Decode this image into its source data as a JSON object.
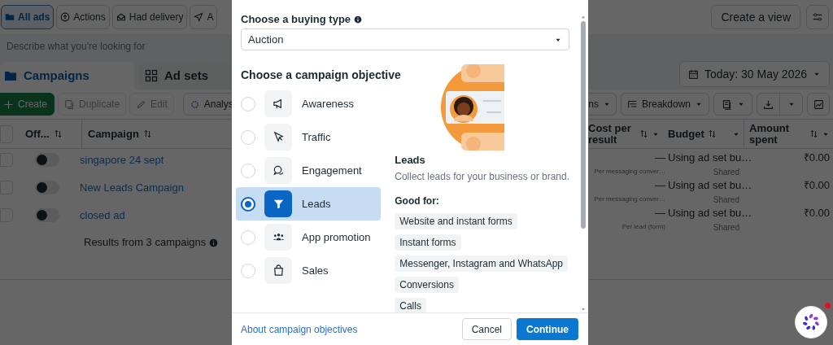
{
  "filters": [
    {
      "label": "All ads",
      "selected": true
    },
    {
      "label": "Actions",
      "selected": false
    },
    {
      "label": "Had delivery",
      "selected": false
    },
    {
      "label": "A",
      "selected": false
    }
  ],
  "create_view": "Create a view",
  "search": {
    "placeholder": "Describe what you're looking for"
  },
  "tabs": [
    {
      "label": "Campaigns",
      "selected": true
    },
    {
      "label": "Ad sets",
      "selected": false
    }
  ],
  "date_range": "Today: 30 May 2026",
  "actions": [
    {
      "label": "Create",
      "kind": "primary",
      "disabled": false
    },
    {
      "label": "Duplicate",
      "kind": "plain",
      "disabled": true
    },
    {
      "label": "Edit",
      "kind": "plain",
      "disabled": true
    },
    {
      "label": "Analys",
      "kind": "plain",
      "disabled": false
    }
  ],
  "right_actions": [
    {
      "label": "ns",
      "kind": "dropdown"
    },
    {
      "label": "Breakdown",
      "kind": "dropdown"
    }
  ],
  "table": {
    "columns": [
      "Off...",
      "Campaign",
      "Cost per result",
      "Budget",
      "Amount spent"
    ],
    "select_all_checked": false,
    "rows": [
      {
        "checked": false,
        "on": false,
        "campaign": "singapore 24 sept",
        "cost": "—",
        "cost_note": "Per messaging conver…",
        "budget": "Using ad set bu…",
        "budget_note": "Shared",
        "spent": "₹0.00"
      },
      {
        "checked": false,
        "on": false,
        "campaign": "New Leads Campaign",
        "cost": "—",
        "cost_note": "Per messaging conver…",
        "budget": "Using ad set bu…",
        "budget_note": "Shared",
        "spent": "₹0.00"
      },
      {
        "checked": false,
        "on": false,
        "campaign": "closed ad",
        "cost": "—",
        "cost_note": "Per lead (form)",
        "budget": "Using ad set bu…",
        "budget_note": "Shared",
        "spent": "₹0.00"
      }
    ],
    "summary": "Results from 3 campaigns"
  },
  "modal": {
    "buying_type_label": "Choose a buying type",
    "buying_type": "Auction",
    "objective_label": "Choose a campaign objective",
    "objectives": [
      {
        "label": "Awareness",
        "selected": false
      },
      {
        "label": "Traffic",
        "selected": false
      },
      {
        "label": "Engagement",
        "selected": false
      },
      {
        "label": "Leads",
        "selected": true
      },
      {
        "label": "App promotion",
        "selected": false
      },
      {
        "label": "Sales",
        "selected": false
      }
    ],
    "detail": {
      "title": "Leads",
      "description": "Collect leads for your business or brand.",
      "good_for_label": "Good for:",
      "good_for": [
        "Website and instant forms",
        "Instant forms",
        "Messenger, Instagram and WhatsApp",
        "Conversions",
        "Calls"
      ]
    },
    "link": "About campaign objectives",
    "buttons": [
      "Cancel",
      "Continue"
    ]
  }
}
